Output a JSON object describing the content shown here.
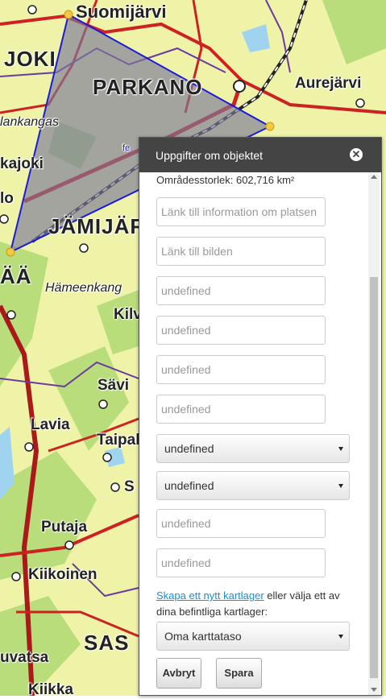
{
  "map": {
    "places": [
      {
        "name": "Suomijärvi"
      },
      {
        "name": "JOKI"
      },
      {
        "name": "PARKANO"
      },
      {
        "name": "Aurejärvi"
      },
      {
        "name": "lankangas"
      },
      {
        "name": "kajoki"
      },
      {
        "name": "lo"
      },
      {
        "name": "JÄMIJÄR"
      },
      {
        "name": "ÄÄ"
      },
      {
        "name": "Hämeenkang"
      },
      {
        "name": "Kilv"
      },
      {
        "name": "Sävi"
      },
      {
        "name": "Lavia"
      },
      {
        "name": "Taipal"
      },
      {
        "name": "S"
      },
      {
        "name": "Putaja"
      },
      {
        "name": "Kiikoinen"
      },
      {
        "name": "SAS"
      },
      {
        "name": "uvatsa"
      },
      {
        "name": "Kiikka"
      },
      {
        "name": "fe"
      }
    ],
    "colors": {
      "background": "#eef3a8",
      "polygon_fill": "#7d7a9a",
      "polygon_stroke": "#1a1adb",
      "road_major": "#cc2222"
    }
  },
  "panel": {
    "title": "Uppgifter om objektet",
    "close_icon": "close-icon",
    "area_text": "Områdesstorlek: 602,716 km²",
    "fields": [
      {
        "placeholder": "Länk till information om platsen"
      },
      {
        "placeholder": "Länk till bilden"
      },
      {
        "placeholder": "undefined"
      },
      {
        "placeholder": "undefined"
      },
      {
        "placeholder": "undefined"
      },
      {
        "placeholder": "undefined"
      }
    ],
    "selects": [
      {
        "value": "undefined"
      },
      {
        "value": "undefined"
      }
    ],
    "fields2": [
      {
        "placeholder": "undefined"
      },
      {
        "placeholder": "undefined"
      }
    ],
    "layer_link": "Skapa ett nytt kartlager",
    "layer_text": " eller välja ett av dina befintliga kartlager:",
    "layer_select": "Oma karttataso",
    "cancel_label": "Avbryt",
    "save_label": "Spara"
  }
}
